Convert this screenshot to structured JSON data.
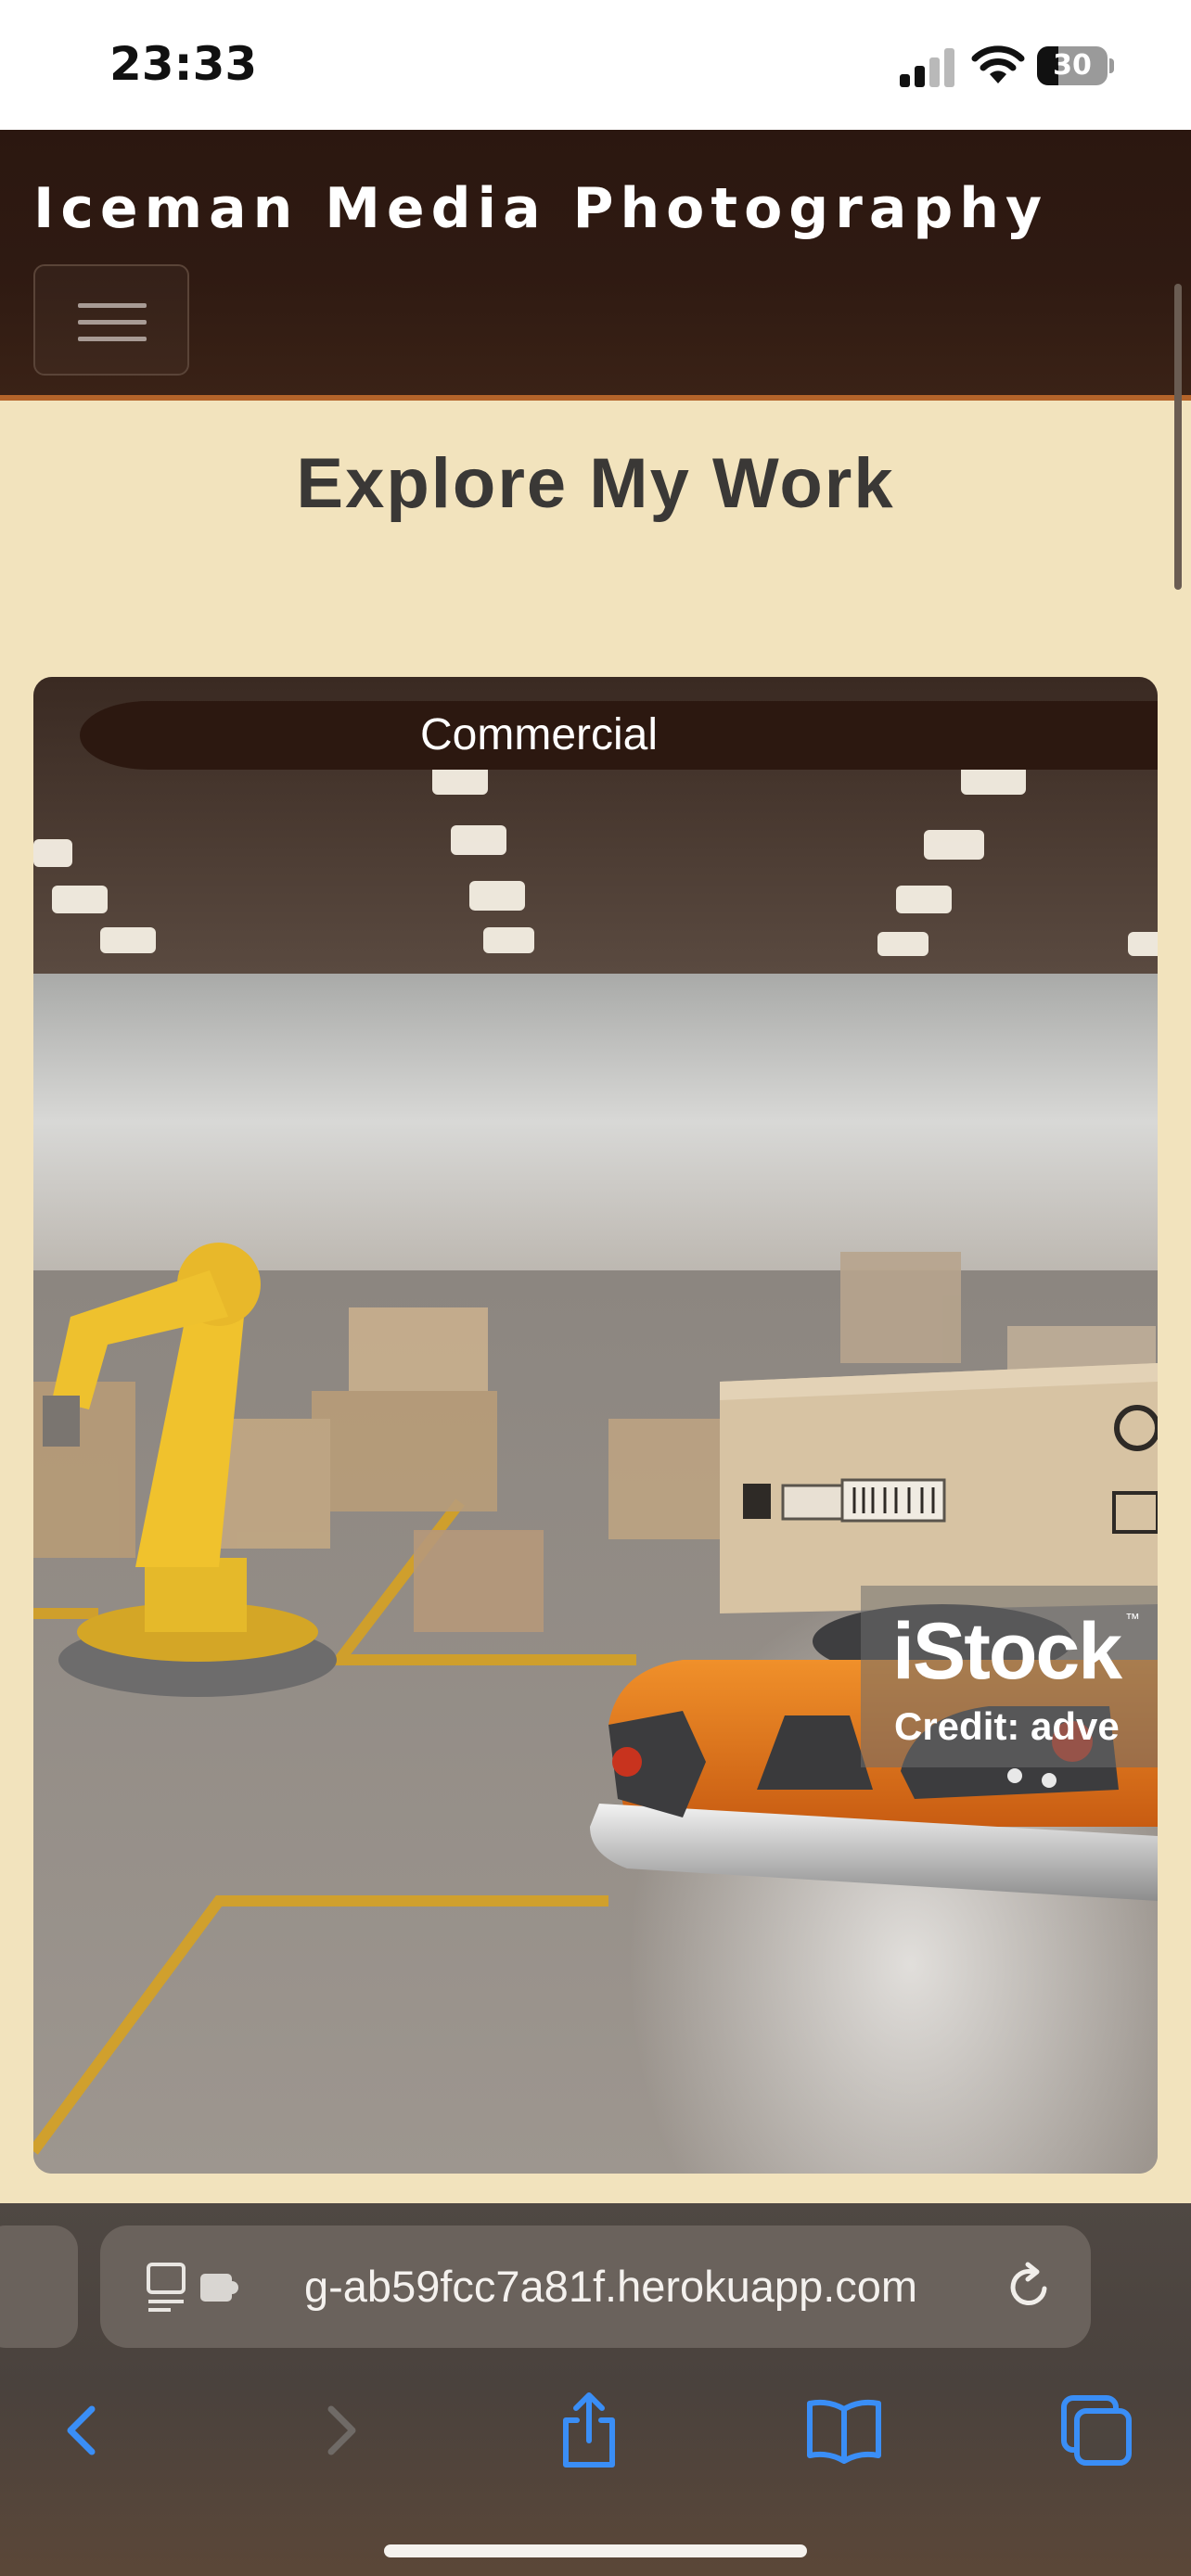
{
  "status_bar": {
    "time": "23:33",
    "battery_level": "30",
    "battery_fraction": 0.3,
    "icons": [
      "signal-icon",
      "wifi-icon",
      "battery-icon"
    ]
  },
  "navbar": {
    "brand": "Iceman Media Photography",
    "toggle_icon": "hamburger-menu-icon",
    "accent_color": "#b4642a",
    "background_color": "#2c1810"
  },
  "page": {
    "background_color": "#f2e3bd",
    "section_title": "Explore My Work"
  },
  "work_cards": [
    {
      "label": "Commercial",
      "image_subject": "warehouse robotic arm and autonomous delivery robot carrying a cardboard box",
      "watermark": {
        "logo": "iStock",
        "trademark": "™",
        "credit": "Credit: adve"
      }
    }
  ],
  "browser": {
    "url": "g-ab59fcc7a81f.herokuapp.com",
    "address_icons": [
      "reader-mode-icon",
      "extension-icon",
      "reload-icon"
    ],
    "toolbar": [
      {
        "name": "back-button",
        "icon": "chevron-left-icon",
        "enabled": true
      },
      {
        "name": "forward-button",
        "icon": "chevron-right-icon",
        "enabled": false
      },
      {
        "name": "share-button",
        "icon": "share-icon",
        "enabled": true
      },
      {
        "name": "bookmarks-button",
        "icon": "book-icon",
        "enabled": true
      },
      {
        "name": "tabs-button",
        "icon": "tabs-icon",
        "enabled": true
      }
    ],
    "accent_color": "#3a8ef6"
  }
}
